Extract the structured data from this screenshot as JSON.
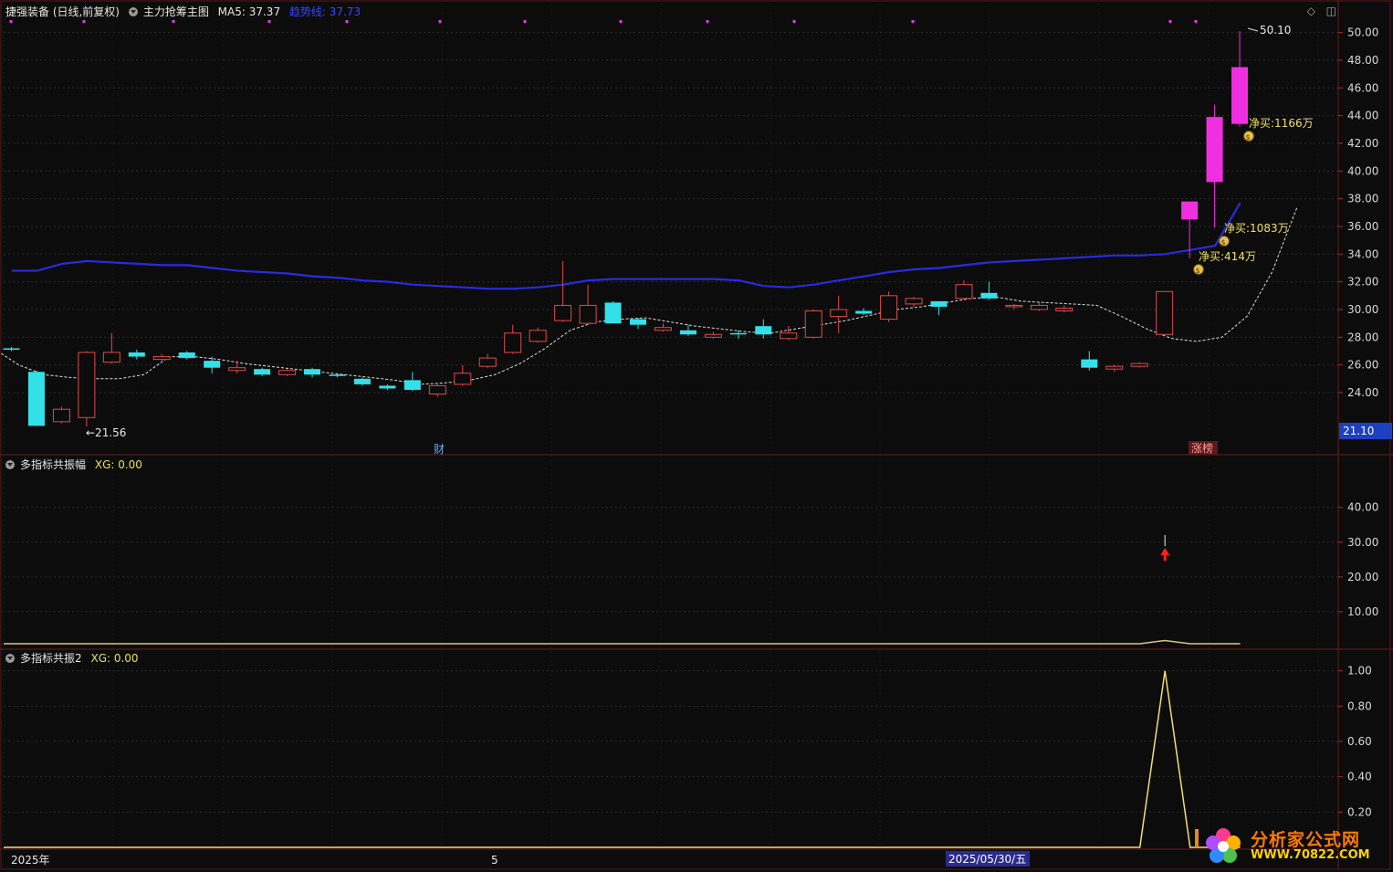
{
  "header": {
    "stock_title": "捷强装备 (日线,前复权)",
    "indicator_name": "主力抢筹主图",
    "ma5_label": "MA5: 37.37",
    "trend_label": "趋势线: 37.73"
  },
  "panel2": {
    "name": "多指标共振幅",
    "value_label": "XG: 0.00"
  },
  "panel3": {
    "name": "多指标共振2",
    "value_label": "XG: 0.00"
  },
  "top_icons": [
    "◇",
    "◫"
  ],
  "x_axis": {
    "labels": [
      "2025年",
      "5",
      "2025/05/30/五"
    ]
  },
  "markers": {
    "cai": "财",
    "zhangbang": "涨榜"
  },
  "last_price_tag": "21.10",
  "logo": {
    "name": "分析家公式网",
    "url": "WWW.70822.COM"
  },
  "chart_data": [
    {
      "type": "candlestick",
      "ylim": [
        21.1,
        50.5
      ],
      "yticks": [
        24,
        26,
        28,
        30,
        32,
        34,
        36,
        38,
        40,
        42,
        44,
        46,
        48,
        50
      ],
      "annotations": {
        "high_label": "50.10",
        "low_label": "←21.56",
        "net_buys": [
          "净买:414万",
          "净买:1083万",
          "净买:1166万"
        ]
      },
      "candles": [
        {
          "o": 27.2,
          "h": 27.3,
          "l": 27.0,
          "c": 27.1
        },
        {
          "o": 25.5,
          "h": 25.6,
          "l": 21.6,
          "c": 21.6
        },
        {
          "o": 21.9,
          "h": 23.0,
          "l": 21.8,
          "c": 22.8
        },
        {
          "o": 22.2,
          "h": 27.0,
          "l": 21.56,
          "c": 26.9
        },
        {
          "o": 26.2,
          "h": 28.3,
          "l": 26.1,
          "c": 26.9
        },
        {
          "o": 26.9,
          "h": 27.1,
          "l": 26.4,
          "c": 26.6
        },
        {
          "o": 26.4,
          "h": 26.8,
          "l": 26.3,
          "c": 26.6
        },
        {
          "o": 26.9,
          "h": 27.0,
          "l": 26.4,
          "c": 26.5
        },
        {
          "o": 26.3,
          "h": 26.6,
          "l": 25.4,
          "c": 25.8
        },
        {
          "o": 25.6,
          "h": 26.3,
          "l": 25.4,
          "c": 25.8
        },
        {
          "o": 25.7,
          "h": 25.8,
          "l": 25.2,
          "c": 25.3
        },
        {
          "o": 25.3,
          "h": 25.7,
          "l": 25.2,
          "c": 25.6
        },
        {
          "o": 25.7,
          "h": 25.8,
          "l": 25.1,
          "c": 25.3
        },
        {
          "o": 25.3,
          "h": 25.4,
          "l": 25.1,
          "c": 25.2
        },
        {
          "o": 25.0,
          "h": 25.1,
          "l": 24.5,
          "c": 24.6
        },
        {
          "o": 24.5,
          "h": 24.6,
          "l": 24.2,
          "c": 24.3
        },
        {
          "o": 24.9,
          "h": 25.5,
          "l": 24.1,
          "c": 24.2
        },
        {
          "o": 23.9,
          "h": 24.6,
          "l": 23.7,
          "c": 24.5
        },
        {
          "o": 24.6,
          "h": 26.0,
          "l": 24.5,
          "c": 25.4
        },
        {
          "o": 25.9,
          "h": 26.8,
          "l": 25.8,
          "c": 26.5
        },
        {
          "o": 26.9,
          "h": 28.9,
          "l": 26.8,
          "c": 28.3
        },
        {
          "o": 27.7,
          "h": 28.7,
          "l": 27.6,
          "c": 28.5
        },
        {
          "o": 29.2,
          "h": 33.5,
          "l": 29.1,
          "c": 30.3
        },
        {
          "o": 29.0,
          "h": 31.8,
          "l": 28.9,
          "c": 30.3
        },
        {
          "o": 30.5,
          "h": 30.6,
          "l": 29.0,
          "c": 29.0
        },
        {
          "o": 29.3,
          "h": 29.4,
          "l": 28.6,
          "c": 28.9
        },
        {
          "o": 28.5,
          "h": 29.0,
          "l": 28.4,
          "c": 28.7
        },
        {
          "o": 28.5,
          "h": 28.9,
          "l": 28.1,
          "c": 28.2
        },
        {
          "o": 28.0,
          "h": 28.4,
          "l": 27.9,
          "c": 28.2
        },
        {
          "o": 28.3,
          "h": 28.5,
          "l": 27.9,
          "c": 28.2
        },
        {
          "o": 28.8,
          "h": 29.3,
          "l": 27.9,
          "c": 28.2
        },
        {
          "o": 27.9,
          "h": 28.8,
          "l": 27.8,
          "c": 28.3
        },
        {
          "o": 28.0,
          "h": 30.0,
          "l": 27.9,
          "c": 29.9
        },
        {
          "o": 29.5,
          "h": 31.0,
          "l": 28.3,
          "c": 30.0
        },
        {
          "o": 29.9,
          "h": 30.1,
          "l": 29.6,
          "c": 29.7
        },
        {
          "o": 29.3,
          "h": 31.3,
          "l": 29.1,
          "c": 31.0
        },
        {
          "o": 30.4,
          "h": 30.9,
          "l": 30.2,
          "c": 30.8
        },
        {
          "o": 30.6,
          "h": 30.6,
          "l": 29.6,
          "c": 30.2
        },
        {
          "o": 30.8,
          "h": 32.1,
          "l": 30.7,
          "c": 31.8
        },
        {
          "o": 31.2,
          "h": 32.0,
          "l": 30.7,
          "c": 30.8
        },
        {
          "o": 30.2,
          "h": 30.4,
          "l": 30.0,
          "c": 30.3
        },
        {
          "o": 30.0,
          "h": 30.5,
          "l": 29.9,
          "c": 30.3
        },
        {
          "o": 29.9,
          "h": 30.3,
          "l": 29.8,
          "c": 30.1
        },
        {
          "o": 26.4,
          "h": 27.0,
          "l": 25.6,
          "c": 25.8
        },
        {
          "o": 25.7,
          "h": 26.0,
          "l": 25.5,
          "c": 25.9
        },
        {
          "o": 25.9,
          "h": 26.2,
          "l": 25.8,
          "c": 26.1
        },
        {
          "o": 28.2,
          "h": 31.3,
          "l": 28.2,
          "c": 31.3
        },
        {
          "o": 36.5,
          "h": 37.8,
          "l": 33.7,
          "c": 37.8
        },
        {
          "o": 39.2,
          "h": 44.8,
          "l": 35.9,
          "c": 43.9
        },
        {
          "o": 43.4,
          "h": 50.1,
          "l": 43.2,
          "c": 47.5
        }
      ],
      "ma5": [
        27.2,
        26.0,
        25.3,
        25.1,
        25.0,
        25.0,
        25.3,
        26.6,
        26.6,
        26.4,
        26.1,
        25.9,
        25.7,
        25.5,
        25.3,
        25.1,
        24.9,
        24.6,
        24.7,
        24.9,
        25.3,
        26.1,
        27.2,
        28.5,
        29.1,
        29.3,
        29.4,
        29.1,
        28.8,
        28.6,
        28.4,
        28.3,
        28.6,
        28.9,
        29.2,
        29.6,
        30.0,
        30.2,
        30.5,
        30.8,
        30.9,
        30.6,
        30.5,
        30.4,
        30.3,
        29.5,
        28.6,
        27.9,
        27.7,
        28.0,
        29.5,
        32.7,
        37.4
      ],
      "trend": [
        32.8,
        32.8,
        33.3,
        33.5,
        33.4,
        33.3,
        33.2,
        33.2,
        33.0,
        32.8,
        32.7,
        32.6,
        32.4,
        32.3,
        32.1,
        32.0,
        31.8,
        31.7,
        31.6,
        31.5,
        31.5,
        31.6,
        31.8,
        32.1,
        32.2,
        32.2,
        32.2,
        32.2,
        32.2,
        32.1,
        31.7,
        31.6,
        31.8,
        32.1,
        32.4,
        32.7,
        32.9,
        33.0,
        33.2,
        33.4,
        33.5,
        33.6,
        33.7,
        33.8,
        33.9,
        33.9,
        34.0,
        34.3,
        34.6,
        37.7
      ]
    },
    {
      "type": "line",
      "title": "多指标共振幅",
      "ylim": [
        0,
        52
      ],
      "yticks": [
        10,
        20,
        30,
        40
      ],
      "values": [
        0.8,
        0.8,
        0.8,
        0.8,
        0.8,
        0.8,
        0.8,
        0.8,
        0.8,
        0.8,
        0.8,
        0.8,
        0.8,
        0.8,
        0.8,
        0.8,
        0.8,
        0.8,
        0.8,
        0.8,
        0.8,
        0.8,
        0.8,
        0.8,
        0.8,
        0.8,
        0.8,
        0.8,
        0.8,
        0.8,
        0.8,
        0.8,
        0.8,
        0.8,
        0.8,
        0.8,
        0.8,
        0.8,
        0.8,
        0.8,
        0.8,
        0.8,
        0.8,
        0.8,
        0.8,
        0.8,
        1.7,
        0.8,
        0.8,
        0.8
      ],
      "signal_index": 46
    },
    {
      "type": "line",
      "title": "多指标共振2",
      "ylim": [
        0,
        1.05
      ],
      "yticks": [
        0.2,
        0.4,
        0.6,
        0.8,
        1.0
      ],
      "values": [
        0,
        0,
        0,
        0,
        0,
        0,
        0,
        0,
        0,
        0,
        0,
        0,
        0,
        0,
        0,
        0,
        0,
        0,
        0,
        0,
        0,
        0,
        0,
        0,
        0,
        0,
        0,
        0,
        0,
        0,
        0,
        0,
        0,
        0,
        0,
        0,
        0,
        0,
        0,
        0,
        0,
        0,
        0,
        0,
        0,
        0,
        1.0,
        0,
        0,
        0
      ]
    }
  ]
}
